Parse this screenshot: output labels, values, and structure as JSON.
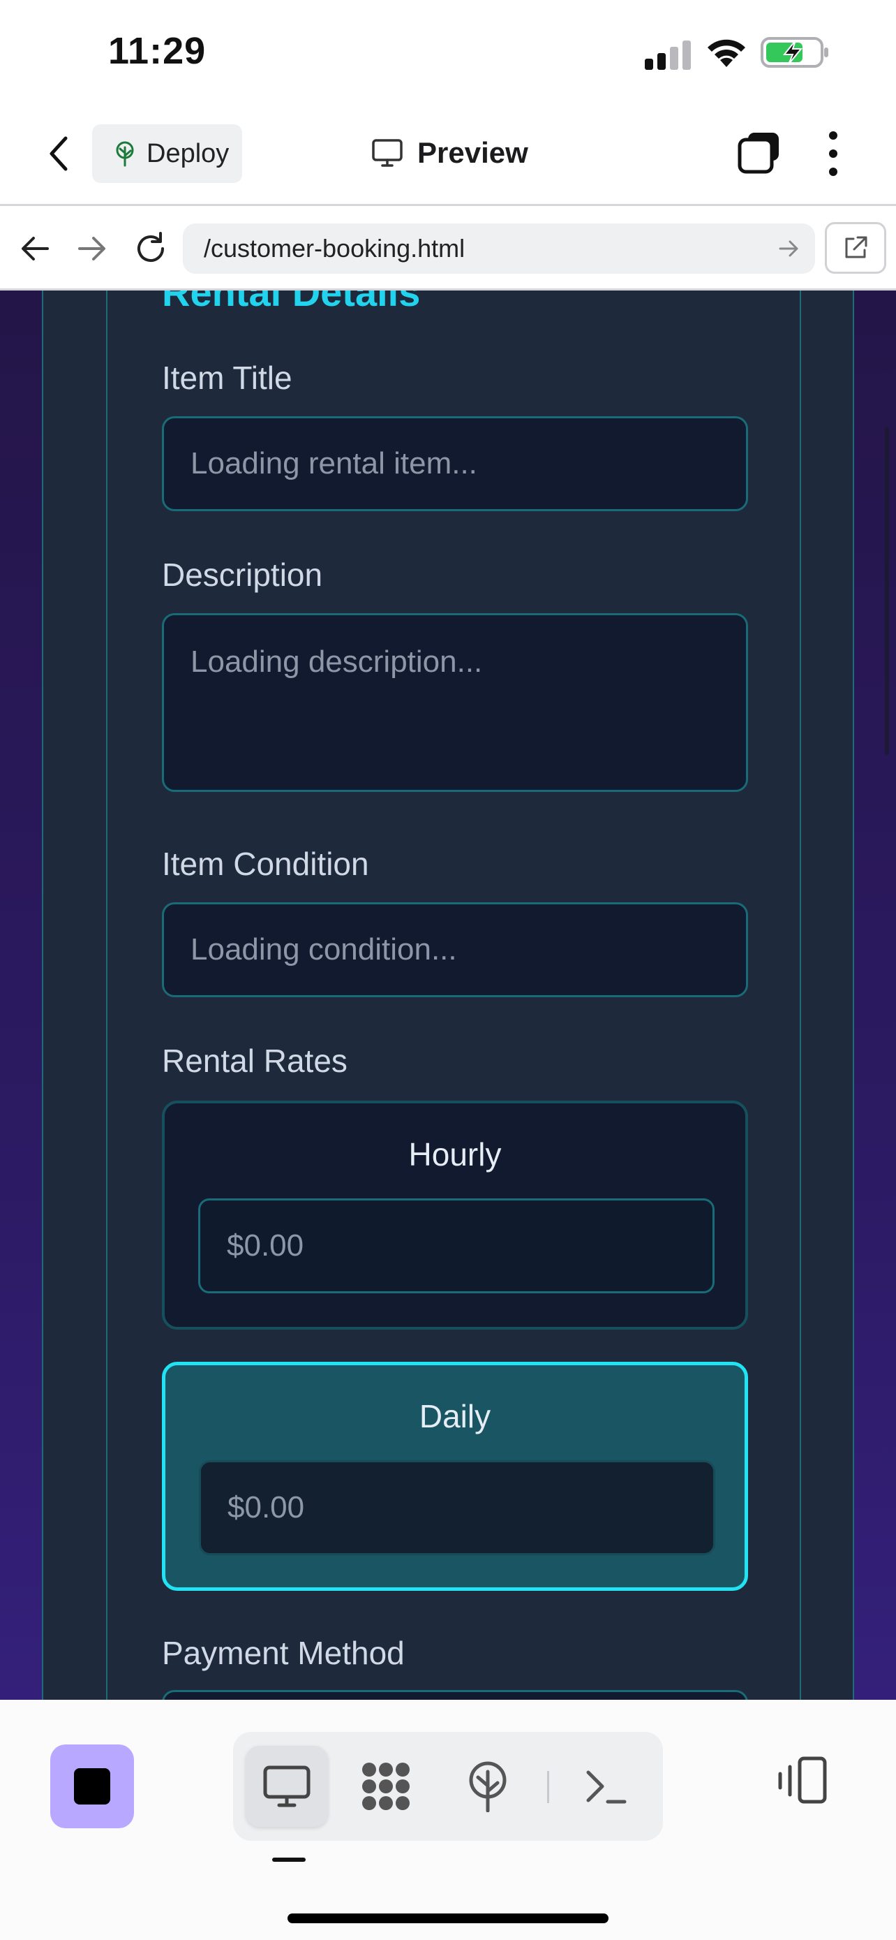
{
  "status_bar": {
    "time": "11:29"
  },
  "app_bar": {
    "deploy_label": "Deploy",
    "preview_label": "Preview"
  },
  "browser": {
    "url": "/customer-booking.html"
  },
  "form": {
    "section_heading": "Rental Details",
    "item_title": {
      "label": "Item Title",
      "placeholder": "Loading rental item..."
    },
    "description": {
      "label": "Description",
      "placeholder": "Loading description..."
    },
    "item_condition": {
      "label": "Item Condition",
      "placeholder": "Loading condition..."
    },
    "rental_rates": {
      "label": "Rental Rates",
      "options": [
        {
          "title": "Hourly",
          "value": "$0.00",
          "selected": false
        },
        {
          "title": "Daily",
          "value": "$0.00",
          "selected": true
        }
      ]
    },
    "payment_method": {
      "label": "Payment Method"
    }
  },
  "colors": {
    "accent": "#22d3ee",
    "card_bg": "#1e293b",
    "input_bg": "#111a2e",
    "selected_rate_bg": "#1a5564",
    "stop_button": "#b8a8ff"
  },
  "icons": {
    "status": [
      "signal-icon",
      "wifi-icon",
      "battery-charging-icon"
    ],
    "app_bar": [
      "back-chevron-icon",
      "deploy-tree-icon",
      "monitor-icon",
      "windows-icon",
      "more-vertical-icon"
    ],
    "browser": [
      "arrow-left-icon",
      "arrow-right-icon",
      "reload-icon",
      "go-arrow-icon",
      "open-external-icon"
    ],
    "toolbar": [
      "stop-icon",
      "monitor-icon",
      "mesh-icon",
      "deploy-tree-icon",
      "terminal-icon",
      "device-toggle-icon"
    ]
  }
}
